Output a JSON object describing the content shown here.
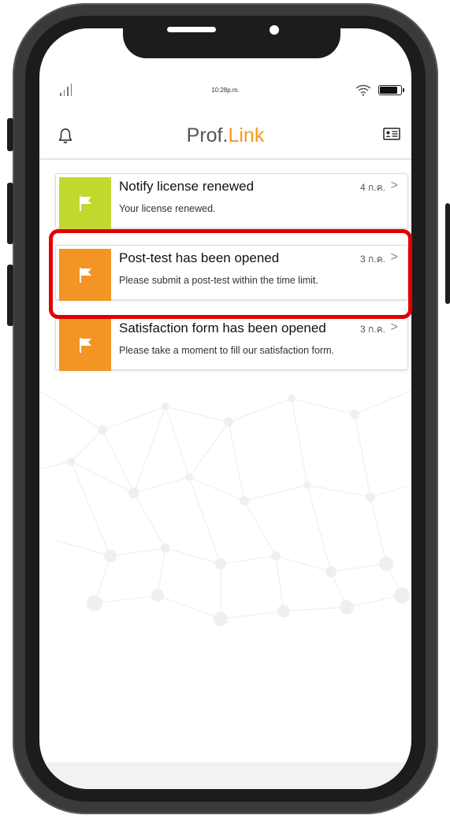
{
  "status_bar": {
    "time": "10:28p.m."
  },
  "header": {
    "title_main": "Prof.",
    "title_accent": "Link"
  },
  "colors": {
    "accent": "#f39c12",
    "flag_green": "#c3d82f",
    "flag_orange": "#f29524",
    "highlight": "#e00000"
  },
  "icons": {
    "left": "bell-icon",
    "right": "id-card-icon",
    "flag": "flag-icon",
    "chevron": "chevron-right-icon"
  },
  "notifications": [
    {
      "title": "Notify license renewed",
      "body": "Your license renewed.",
      "date": "4 ก.ค.",
      "chevron": ">"
    },
    {
      "title": "Post-test has been opened",
      "body": "Please submit a post-test within the time limit.",
      "date": "3 ก.ค.",
      "chevron": ">"
    },
    {
      "title": "Satisfaction form has been opened",
      "body": "Please take a moment to fill our satisfaction form.",
      "date": "3 ก.ค.",
      "chevron": ">"
    }
  ]
}
